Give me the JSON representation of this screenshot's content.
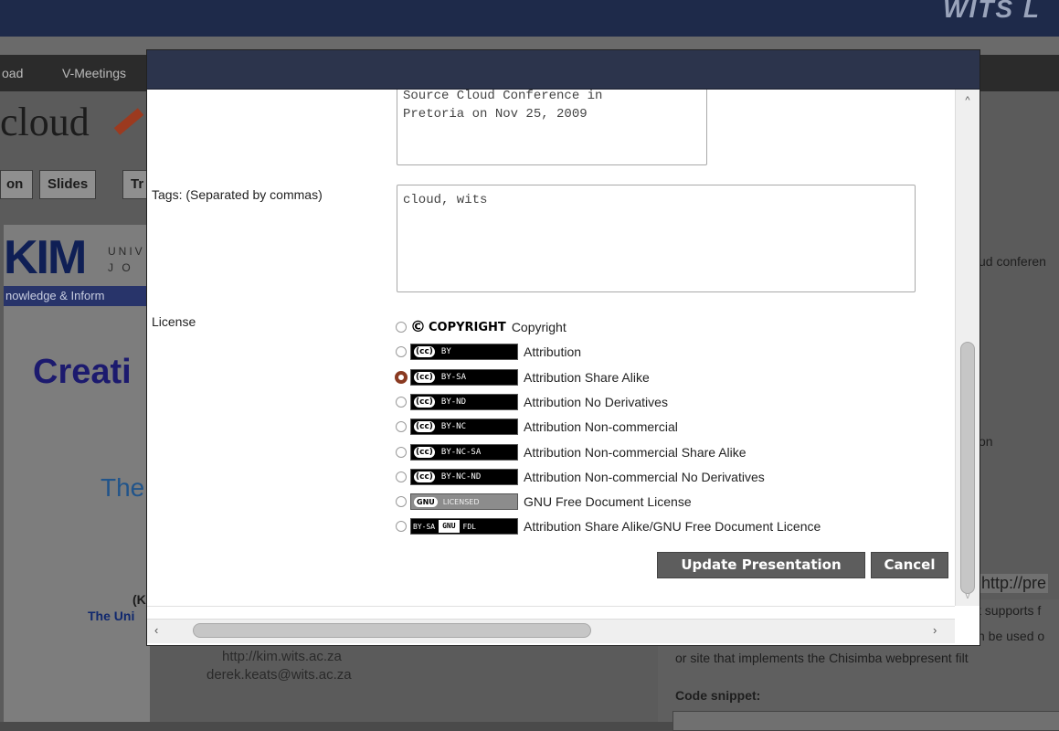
{
  "background": {
    "banner_text": "WITS L",
    "nav": [
      "oad",
      "V-Meetings"
    ],
    "logo_text": "cloud",
    "tabs": [
      "on",
      "Slides",
      "Tr"
    ],
    "slide": {
      "kim": "KIM",
      "univ_line1": "UNIV",
      "univ_line2": "J O",
      "knowledge": "nowledge & Inform",
      "creat": "Creati",
      "the": "The",
      "k_line": "(K",
      "uni_line": "The Uni",
      "url": "http://kim.wits.ac.za",
      "email": "derek.keats@wits.ac.za"
    },
    "right_texts": {
      "conferen": "ud conferen",
      "on": "on",
      "http": "http://pre",
      "supports": "t supports f",
      "used": "n be used o",
      "site": "or site that implements the Chisimba webpresent filt",
      "code": "Code snippet:"
    }
  },
  "modal": {
    "description_value": "Source Cloud Conference in\nPretoria on Nov 25, 2009",
    "tags_label": "Tags: (Separated by commas)",
    "tags_value": "cloud, wits",
    "license_label": "License",
    "licenses": [
      {
        "badge_type": "copyright",
        "badge_text": "COPYRIGHT",
        "label": "Copyright",
        "checked": false
      },
      {
        "badge_type": "cc",
        "badge_text": "BY",
        "label": "Attribution",
        "checked": false
      },
      {
        "badge_type": "cc",
        "badge_text": "BY-SA",
        "label": "Attribution Share Alike",
        "checked": true
      },
      {
        "badge_type": "cc",
        "badge_text": "BY-ND",
        "label": "Attribution No Derivatives",
        "checked": false
      },
      {
        "badge_type": "cc",
        "badge_text": "BY-NC",
        "label": "Attribution Non-commercial",
        "checked": false
      },
      {
        "badge_type": "cc",
        "badge_text": "BY-NC-SA",
        "label": "Attribution Non-commercial Share Alike",
        "checked": false
      },
      {
        "badge_type": "cc",
        "badge_text": "BY-NC-ND",
        "label": "Attribution Non-commercial No Derivatives",
        "checked": false
      },
      {
        "badge_type": "gnu",
        "badge_text": "LICENSED",
        "label": "GNU Free Document License",
        "checked": false
      },
      {
        "badge_type": "gfdl",
        "badge_text": "BY-SA",
        "badge_text2": "FDL",
        "label": "Attribution Share Alike/GNU Free Document Licence",
        "checked": false
      }
    ],
    "update_button": "Update Presentation",
    "cancel_button": "Cancel",
    "accent_checked": "#8a3a21"
  },
  "icons": {
    "scroll_up": "chevron-up-icon",
    "scroll_down": "chevron-down-icon",
    "scroll_left": "chevron-left-icon",
    "scroll_right": "chevron-right-icon"
  }
}
